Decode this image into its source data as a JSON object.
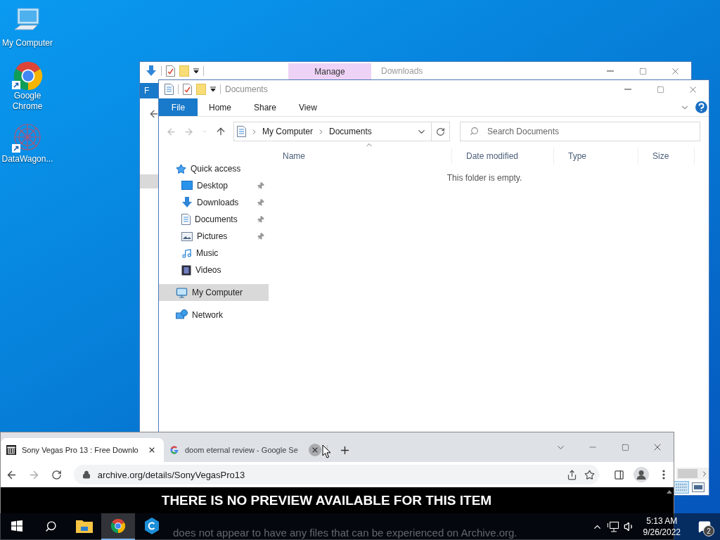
{
  "desktop_icons": [
    {
      "label": "My Computer",
      "kind": "computer",
      "shortcut": false
    },
    {
      "label": "Google Chrome",
      "kind": "chrome",
      "shortcut": true
    },
    {
      "label": "DataWagon...",
      "kind": "datawagon",
      "shortcut": true
    }
  ],
  "back_window": {
    "title": "Downloads",
    "context_tab": "Manage",
    "ribbon_tab": "F"
  },
  "explorer": {
    "title": "Documents",
    "ribbon_tabs": [
      {
        "label": "File",
        "selected": true
      },
      {
        "label": "Home",
        "selected": false
      },
      {
        "label": "Share",
        "selected": false
      },
      {
        "label": "View",
        "selected": false
      }
    ],
    "breadcrumb": [
      "My Computer",
      "Documents"
    ],
    "search": {
      "placeholder": "Search Documents"
    },
    "columns": [
      "Name",
      "Date modified",
      "Type",
      "Size"
    ],
    "empty_message": "This folder is empty.",
    "nav": [
      {
        "label": "Quick access",
        "kind": "quick",
        "selected": false,
        "children": [
          {
            "label": "Desktop",
            "kind": "desktop",
            "pinned": true,
            "selected": false
          },
          {
            "label": "Downloads",
            "kind": "downloads",
            "pinned": true,
            "selected": false
          },
          {
            "label": "Documents",
            "kind": "documents",
            "pinned": true,
            "selected": false
          },
          {
            "label": "Pictures",
            "kind": "pictures",
            "pinned": true,
            "selected": false
          },
          {
            "label": "Music",
            "kind": "music",
            "pinned": false,
            "selected": false
          },
          {
            "label": "Videos",
            "kind": "videos",
            "pinned": false,
            "selected": false
          }
        ]
      },
      {
        "label": "My Computer",
        "kind": "computer",
        "selected": true
      },
      {
        "label": "Network",
        "kind": "network",
        "selected": false
      }
    ]
  },
  "browser": {
    "tabs": [
      {
        "title": "Sony Vegas Pro 13 : Free Downlo",
        "kind": "archive",
        "selected": true,
        "close_hovered": false
      },
      {
        "title": "doom eternal review - Google Se",
        "kind": "google",
        "selected": false,
        "close_hovered": true
      }
    ],
    "url": "archive.org/details/SonyVegasPro13",
    "heading": "THERE IS NO PREVIEW AVAILABLE FOR THIS ITEM",
    "message": "does not appear to have any files that can be experienced on Archive.org."
  },
  "taskbar": {
    "apps": [
      {
        "kind": "explorer",
        "selected": false
      },
      {
        "kind": "chrome",
        "selected": true
      },
      {
        "kind": "cube",
        "selected": false
      }
    ],
    "time": "5:13 AM",
    "date": "9/26/2022",
    "notifications": "2"
  }
}
